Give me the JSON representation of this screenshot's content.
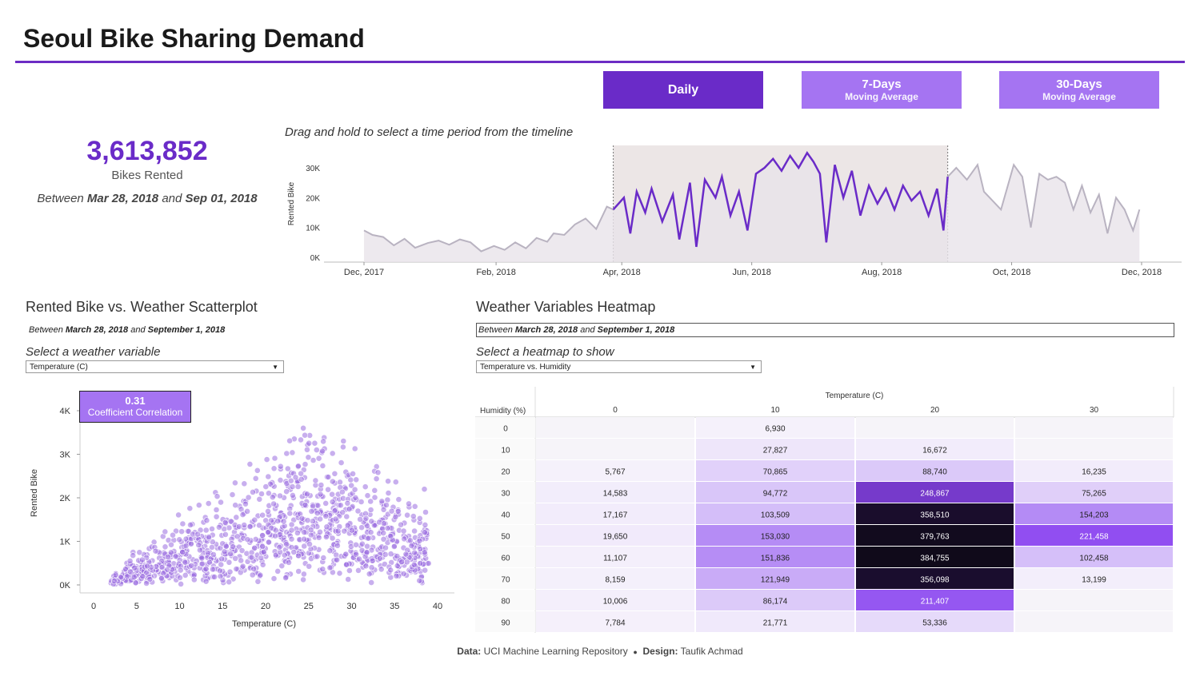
{
  "header": {
    "title": "Seoul Bike Sharing Demand"
  },
  "buttons": {
    "daily": "Daily",
    "ma7_title": "7-Days",
    "ma7_sub": "Moving Average",
    "ma30_title": "30-Days",
    "ma30_sub": "Moving Average"
  },
  "kpi": {
    "value": "3,613,852",
    "label": "Bikes Rented",
    "between_word": "Between",
    "start": "Mar 28, 2018",
    "and_word": "and",
    "end": "Sep 01, 2018"
  },
  "timeseries": {
    "caption": "Drag and hold to select a time period from the timeline",
    "ylabel": "Rented Bike",
    "yticks": [
      "0K",
      "10K",
      "20K",
      "30K"
    ],
    "xticks": [
      "Dec, 2017",
      "Feb, 2018",
      "Apr, 2018",
      "Jun, 2018",
      "Aug, 2018",
      "Oct, 2018",
      "Dec, 2018"
    ],
    "highlight_color": "#6a2bc8",
    "base_color": "#b9b3c1"
  },
  "scatter": {
    "title": "Rented Bike vs. Weather Scatterplot",
    "range_between": "Between",
    "range_start": "March 28, 2018",
    "range_and": "and",
    "range_end": "September 1, 2018",
    "select_label": "Select a weather variable",
    "selected_variable": "Temperature (C)",
    "correlation_value": "0.31",
    "correlation_label": "Coefficient Correlation",
    "xlabel": "Temperature (C)",
    "ylabel": "Rented Bike",
    "xticks": [
      "0",
      "5",
      "10",
      "15",
      "20",
      "25",
      "30",
      "35",
      "40"
    ],
    "yticks": [
      "0K",
      "1K",
      "2K",
      "3K",
      "4K"
    ],
    "point_color": "#9a6ee0"
  },
  "heatmap": {
    "title": "Weather Variables Heatmap",
    "range_between": "Between",
    "range_start": "March 28, 2018",
    "range_and": "and",
    "range_end": "September 1, 2018",
    "select_label": "Select a heatmap to show",
    "selected_heatmap": "Temperature vs. Humidity",
    "col_header": "Temperature (C)",
    "row_header": "Humidity (%)"
  },
  "chart_data": [
    {
      "type": "line",
      "title": "",
      "xlabel": "",
      "ylabel": "Rented Bike",
      "x_range": [
        "Dec, 2017",
        "Nov 30, 2018"
      ],
      "ylim": [
        0,
        38000
      ],
      "selection": [
        "Mar 28, 2018",
        "Sep 01, 2018"
      ],
      "series": [
        {
          "points": [
            [
              "2017-12-01",
              9000
            ],
            [
              "2017-12-05",
              7500
            ],
            [
              "2017-12-10",
              6800
            ],
            [
              "2017-12-15",
              4000
            ],
            [
              "2017-12-20",
              6200
            ],
            [
              "2017-12-25",
              3200
            ],
            [
              "2017-12-31",
              4800
            ],
            [
              "2018-01-05",
              5600
            ],
            [
              "2018-01-10",
              4200
            ],
            [
              "2018-01-15",
              6000
            ],
            [
              "2018-01-20",
              5000
            ],
            [
              "2018-01-25",
              2000
            ],
            [
              "2018-01-31",
              3800
            ],
            [
              "2018-02-05",
              2500
            ],
            [
              "2018-02-10",
              5000
            ],
            [
              "2018-02-15",
              3000
            ],
            [
              "2018-02-20",
              6500
            ],
            [
              "2018-02-25",
              5200
            ],
            [
              "2018-02-28",
              8000
            ],
            [
              "2018-03-05",
              7500
            ],
            [
              "2018-03-10",
              11000
            ],
            [
              "2018-03-15",
              13000
            ],
            [
              "2018-03-20",
              9500
            ],
            [
              "2018-03-25",
              17000
            ],
            [
              "2018-03-28",
              16000
            ],
            [
              "2018-04-02",
              20000
            ],
            [
              "2018-04-05",
              8000
            ],
            [
              "2018-04-08",
              22000
            ],
            [
              "2018-04-12",
              15000
            ],
            [
              "2018-04-15",
              23000
            ],
            [
              "2018-04-20",
              12000
            ],
            [
              "2018-04-25",
              21000
            ],
            [
              "2018-04-28",
              6000
            ],
            [
              "2018-05-03",
              25000
            ],
            [
              "2018-05-06",
              3500
            ],
            [
              "2018-05-10",
              26000
            ],
            [
              "2018-05-15",
              20000
            ],
            [
              "2018-05-18",
              27000
            ],
            [
              "2018-05-22",
              14000
            ],
            [
              "2018-05-26",
              22000
            ],
            [
              "2018-05-30",
              9000
            ],
            [
              "2018-06-03",
              28000
            ],
            [
              "2018-06-07",
              30000
            ],
            [
              "2018-06-11",
              33000
            ],
            [
              "2018-06-15",
              29000
            ],
            [
              "2018-06-19",
              34000
            ],
            [
              "2018-06-23",
              30000
            ],
            [
              "2018-06-27",
              35000
            ],
            [
              "2018-06-30",
              32000
            ],
            [
              "2018-07-03",
              28000
            ],
            [
              "2018-07-06",
              5000
            ],
            [
              "2018-07-10",
              31000
            ],
            [
              "2018-07-14",
              20000
            ],
            [
              "2018-07-18",
              29000
            ],
            [
              "2018-07-22",
              14000
            ],
            [
              "2018-07-26",
              24000
            ],
            [
              "2018-07-30",
              18000
            ],
            [
              "2018-08-03",
              23000
            ],
            [
              "2018-08-07",
              16000
            ],
            [
              "2018-08-11",
              24000
            ],
            [
              "2018-08-15",
              19000
            ],
            [
              "2018-08-19",
              22000
            ],
            [
              "2018-08-23",
              14000
            ],
            [
              "2018-08-27",
              23000
            ],
            [
              "2018-08-30",
              9000
            ],
            [
              "2018-09-01",
              27000
            ],
            [
              "2018-09-05",
              30000
            ],
            [
              "2018-09-10",
              26000
            ],
            [
              "2018-09-15",
              31000
            ],
            [
              "2018-09-18",
              22000
            ],
            [
              "2018-09-22",
              19000
            ],
            [
              "2018-09-26",
              16000
            ],
            [
              "2018-10-02",
              31000
            ],
            [
              "2018-10-06",
              27000
            ],
            [
              "2018-10-10",
              10000
            ],
            [
              "2018-10-14",
              28000
            ],
            [
              "2018-10-18",
              26000
            ],
            [
              "2018-10-22",
              27000
            ],
            [
              "2018-10-26",
              25000
            ],
            [
              "2018-10-30",
              16000
            ],
            [
              "2018-11-03",
              24000
            ],
            [
              "2018-11-07",
              15000
            ],
            [
              "2018-11-11",
              21000
            ],
            [
              "2018-11-15",
              8000
            ],
            [
              "2018-11-19",
              20000
            ],
            [
              "2018-11-23",
              16000
            ],
            [
              "2018-11-27",
              9000
            ],
            [
              "2018-11-30",
              16000
            ]
          ]
        }
      ]
    },
    {
      "type": "scatter",
      "title": "",
      "xlabel": "Temperature (C)",
      "ylabel": "Rented Bike",
      "xlim": [
        -1,
        41
      ],
      "ylim": [
        0,
        4200
      ],
      "trend": "Bikes rented generally rise with temperature, peaking near 3,500 around 23–27 C, with a coefficient correlation of 0.31"
    },
    {
      "type": "heatmap",
      "title": "",
      "xlabel": "Temperature (C)",
      "ylabel": "Humidity (%)",
      "columns": [
        "0",
        "10",
        "20",
        "30"
      ],
      "rows": [
        "0",
        "10",
        "20",
        "30",
        "40",
        "50",
        "60",
        "70",
        "80",
        "90"
      ],
      "values": [
        [
          null,
          6930,
          null,
          null
        ],
        [
          null,
          27827,
          16672,
          null
        ],
        [
          5767,
          70865,
          88740,
          16235
        ],
        [
          14583,
          94772,
          248867,
          75265
        ],
        [
          17167,
          103509,
          358510,
          154203
        ],
        [
          19650,
          153030,
          379763,
          221458
        ],
        [
          11107,
          151836,
          384755,
          102458
        ],
        [
          8159,
          121949,
          356098,
          13199
        ],
        [
          10006,
          86174,
          211407,
          null
        ],
        [
          7784,
          21771,
          53336,
          null
        ]
      ],
      "labels": [
        [
          "",
          "6,930",
          "",
          ""
        ],
        [
          "",
          "27,827",
          "16,672",
          ""
        ],
        [
          "5,767",
          "70,865",
          "88,740",
          "16,235"
        ],
        [
          "14,583",
          "94,772",
          "248,867",
          "75,265"
        ],
        [
          "17,167",
          "103,509",
          "358,510",
          "154,203"
        ],
        [
          "19,650",
          "153,030",
          "379,763",
          "221,458"
        ],
        [
          "11,107",
          "151,836",
          "384,755",
          "102,458"
        ],
        [
          "8,159",
          "121,949",
          "356,098",
          "13,199"
        ],
        [
          "10,006",
          "86,174",
          "211,407",
          ""
        ],
        [
          "7,784",
          "21,771",
          "53,336",
          ""
        ]
      ]
    }
  ],
  "footer": {
    "data_label": "Data:",
    "data_value": "UCI Machine Learning Repository",
    "bullet": "●",
    "design_label": "Design:",
    "design_value": "Taufik Achmad"
  }
}
